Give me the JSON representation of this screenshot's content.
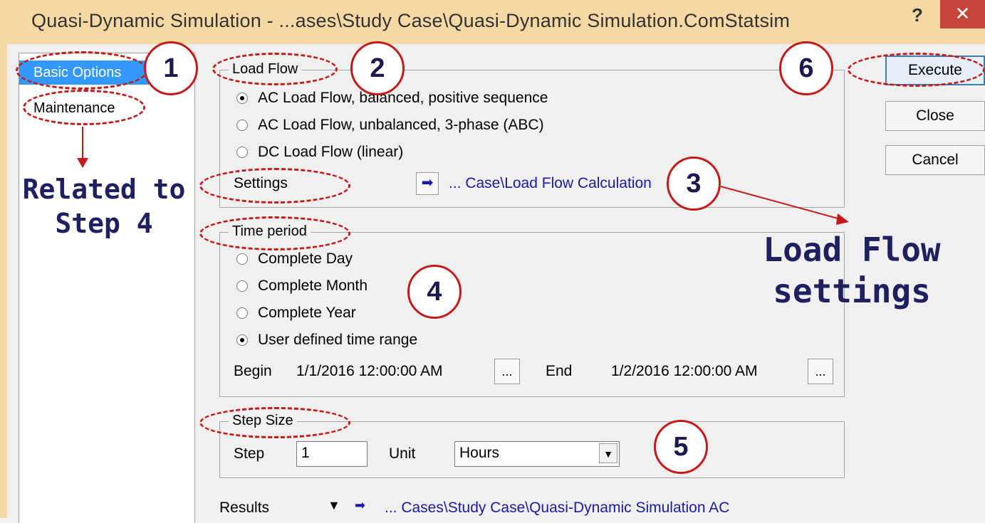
{
  "window": {
    "title": "Quasi-Dynamic Simulation - ...ases\\Study Case\\Quasi-Dynamic Simulation.ComStatsim",
    "help": "?",
    "close_glyph": "✕"
  },
  "sidebar": {
    "items": [
      {
        "label": "Basic Options",
        "selected": true
      },
      {
        "label": "Maintenance",
        "selected": false
      }
    ]
  },
  "load_flow": {
    "legend": "Load Flow",
    "options": [
      {
        "label": "AC Load Flow, balanced, positive sequence",
        "checked": true
      },
      {
        "label": "AC Load Flow, unbalanced, 3-phase (ABC)",
        "checked": false
      },
      {
        "label": "DC Load Flow (linear)",
        "checked": false
      }
    ],
    "settings_label": "Settings",
    "settings_arrow": "➡",
    "settings_link": "... Case\\Load Flow Calculation"
  },
  "time_period": {
    "legend": "Time period",
    "options": [
      {
        "label": "Complete Day",
        "checked": false
      },
      {
        "label": "Complete Month",
        "checked": false
      },
      {
        "label": "Complete Year",
        "checked": false
      },
      {
        "label": "User defined time range",
        "checked": true
      }
    ],
    "begin_label": "Begin",
    "begin_value": "1/1/2016 12:00:00 AM",
    "end_label": "End",
    "end_value": "1/2/2016 12:00:00 AM",
    "picker_glyph": "..."
  },
  "step_size": {
    "legend": "Step Size",
    "step_label": "Step",
    "step_value": "1",
    "unit_label": "Unit",
    "unit_value": "Hours",
    "dropdown_glyph": "▼"
  },
  "results": {
    "label": "Results",
    "dropdown_glyph": "▼",
    "arrow": "➡",
    "link": "... Cases\\Study Case\\Quasi-Dynamic Simulation AC"
  },
  "buttons": {
    "execute": "Execute",
    "close": "Close",
    "cancel": "Cancel"
  },
  "annotations": {
    "markers": [
      "1",
      "2",
      "3",
      "4",
      "5",
      "6"
    ],
    "note_step4_line1": "Related to",
    "note_step4_line2": "Step 4",
    "note_lf_line1": "Load Flow",
    "note_lf_line2": "settings",
    "color": "#c41a1a",
    "text_color": "#1f2060"
  },
  "colors": {
    "titlebar": "#f6d8a4",
    "selection": "#3399ff",
    "link": "#1a1aa6",
    "close_button": "#c7463c"
  }
}
